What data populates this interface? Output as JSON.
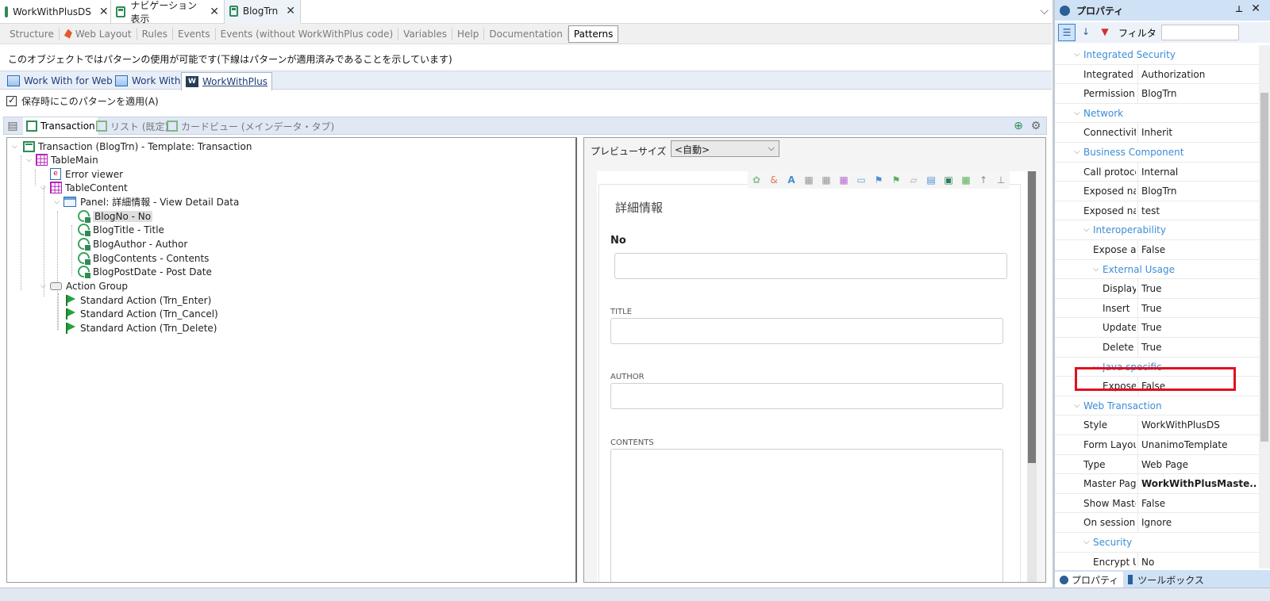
{
  "doc_tabs": [
    {
      "label": "WorkWithPlusDS"
    },
    {
      "label": "ナビゲーション表示"
    },
    {
      "label": "BlogTrn"
    }
  ],
  "section_tabs": [
    "Structure",
    "Web Layout",
    "Rules",
    "Events",
    "Events (without WorkWithPlus code)",
    "Variables",
    "Help",
    "Documentation",
    "Patterns"
  ],
  "pattern_note": "このオブジェクトではパターンの使用が可能です(下線はパターンが適用済みであることを示しています)",
  "pattern_tabs": [
    "Work With for Web",
    "Work With",
    "WorkWithPlus"
  ],
  "apply_on_save": "保存時にこのパターンを適用(A)",
  "inner_tabs": [
    "Transaction",
    "リスト (既定)",
    "カードビュー (メインデータ・タブ)"
  ],
  "tree": {
    "root": "Transaction (BlogTrn) - Template: Transaction",
    "table_main": "TableMain",
    "error_viewer": "Error viewer",
    "table_content": "TableContent",
    "panel": "Panel: 詳細情報 - View Detail Data",
    "attrs": [
      "BlogNo - No",
      "BlogTitle - Title",
      "BlogAuthor - Author",
      "BlogContents - Contents",
      "BlogPostDate - Post Date"
    ],
    "action_group": "Action Group",
    "actions": [
      "Standard Action (Trn_Enter)",
      "Standard Action (Trn_Cancel)",
      "Standard Action (Trn_Delete)"
    ]
  },
  "preview": {
    "size_label": "プレビューサイズ",
    "size_value": "<自動>",
    "form_title": "詳細情報",
    "fields": [
      "No",
      "TITLE",
      "AUTHOR",
      "CONTENTS"
    ]
  },
  "properties": {
    "title": "プロパティ",
    "filter_label": "フィルタ",
    "rows": [
      {
        "name": "Integrated Security",
        "value": "",
        "type": "cat",
        "level": 0
      },
      {
        "name": "Integrated Se",
        "value": "Authorization",
        "type": "prop",
        "level": 0
      },
      {
        "name": "Permission P",
        "value": "BlogTrn",
        "type": "prop",
        "level": 0
      },
      {
        "name": "Network",
        "value": "",
        "type": "cat",
        "level": 0
      },
      {
        "name": "Connectivity",
        "value": "Inherit",
        "type": "prop",
        "level": 0
      },
      {
        "name": "Business Component",
        "value": "",
        "type": "cat",
        "level": 0
      },
      {
        "name": "Call protocol",
        "value": "Internal",
        "type": "prop",
        "level": 0
      },
      {
        "name": "Exposed nan",
        "value": "BlogTrn",
        "type": "prop",
        "level": 0
      },
      {
        "name": "Exposed nan",
        "value": "test",
        "type": "prop",
        "level": 0
      },
      {
        "name": "Interoperability",
        "value": "",
        "type": "cat",
        "level": 1
      },
      {
        "name": "Expose as",
        "value": "False",
        "type": "prop",
        "level": 1
      },
      {
        "name": "External Usage",
        "value": "",
        "type": "cat",
        "level": 2
      },
      {
        "name": "Display",
        "value": "True",
        "type": "prop",
        "level": 2
      },
      {
        "name": "Insert",
        "value": "True",
        "type": "prop",
        "level": 2
      },
      {
        "name": "Update",
        "value": "True",
        "type": "prop",
        "level": 2
      },
      {
        "name": "Delete",
        "value": "True",
        "type": "prop",
        "level": 2
      },
      {
        "name": "Java specific",
        "value": "",
        "type": "cat",
        "level": 2
      },
      {
        "name": "Expose",
        "value": "False",
        "type": "prop",
        "level": 2
      },
      {
        "name": "Web Transaction",
        "value": "",
        "type": "cat",
        "level": 0
      },
      {
        "name": "Style",
        "value": "WorkWithPlusDS",
        "type": "prop",
        "level": 0
      },
      {
        "name": "Form Layout",
        "value": "UnanimoTemplate",
        "type": "prop",
        "level": 0
      },
      {
        "name": "Type",
        "value": "Web Page",
        "type": "prop",
        "level": 0
      },
      {
        "name": "Master Page",
        "value": "WorkWithPlusMaste...",
        "type": "prop",
        "level": 0,
        "bold": true
      },
      {
        "name": "Show Master",
        "value": "False",
        "type": "prop",
        "level": 0
      },
      {
        "name": "On session ti",
        "value": "Ignore",
        "type": "prop",
        "level": 0
      },
      {
        "name": "Security",
        "value": "",
        "type": "cat",
        "level": 1
      },
      {
        "name": "Encrypt UI",
        "value": "No",
        "type": "prop",
        "level": 1
      }
    ],
    "footer_tabs": [
      "プロパティ",
      "ツールボックス"
    ]
  }
}
